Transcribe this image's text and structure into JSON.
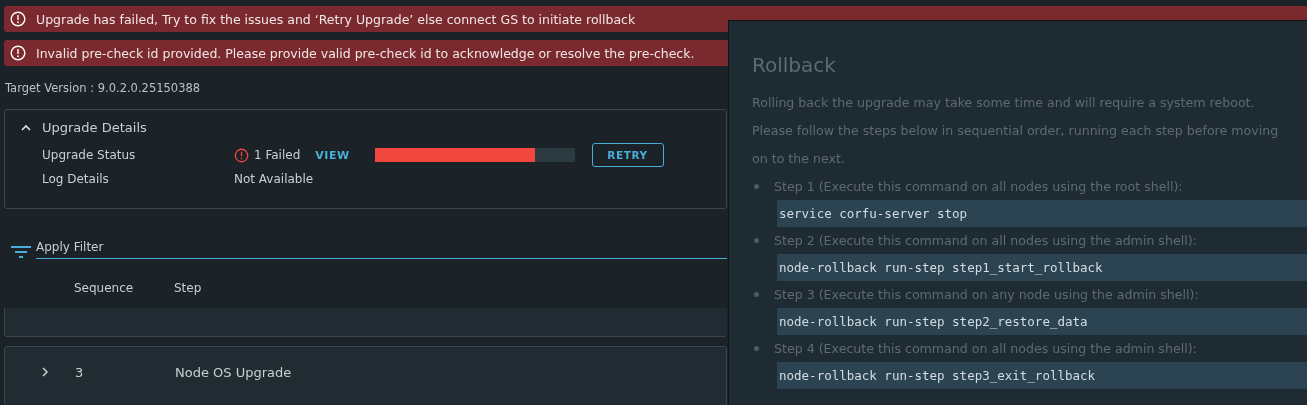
{
  "alerts": [
    "Upgrade has failed, Try to fix the issues and ‘Retry Upgrade’ else connect GS to initiate rollback",
    "Invalid pre-check id provided. Please provide valid pre-check id to acknowledge or resolve the pre-check."
  ],
  "target_version": "Target Version : 9.0.2.0.25150388",
  "details": {
    "title": "Upgrade Details",
    "expanded": true,
    "status_label": "Upgrade Status",
    "status": "1 Failed",
    "view": "VIEW",
    "level": 0.8,
    "retry": "RETRY",
    "log_label": "Log Details",
    "log_value": "Not Available"
  },
  "filter": {
    "placeholder": "Apply Filter"
  },
  "table": {
    "columns": [
      "Sequence",
      "Step"
    ],
    "rows": [
      {
        "sequence": "3",
        "step": "Node OS Upgrade",
        "expanded": false
      }
    ]
  },
  "rollback": {
    "title": "Rollback",
    "intro": [
      "Rolling back the upgrade may take some time and will require a system reboot.",
      "Please follow the steps below in sequential order, running each step before moving on to the next."
    ],
    "steps": [
      {
        "text": "Step 1 (Execute this command on all nodes using the root shell):",
        "command": "service corfu-server stop"
      },
      {
        "text": "Step 2 (Execute this command on all nodes using the admin shell):",
        "command": "node-rollback run-step step1_start_rollback"
      },
      {
        "text": "Step 3 (Execute this command on any node using the admin shell):",
        "command": "node-rollback run-step step2_restore_data"
      },
      {
        "text": "Step 4 (Execute this command on all nodes using the admin shell):",
        "command": "node-rollback run-step step3_exit_rollback"
      }
    ]
  }
}
